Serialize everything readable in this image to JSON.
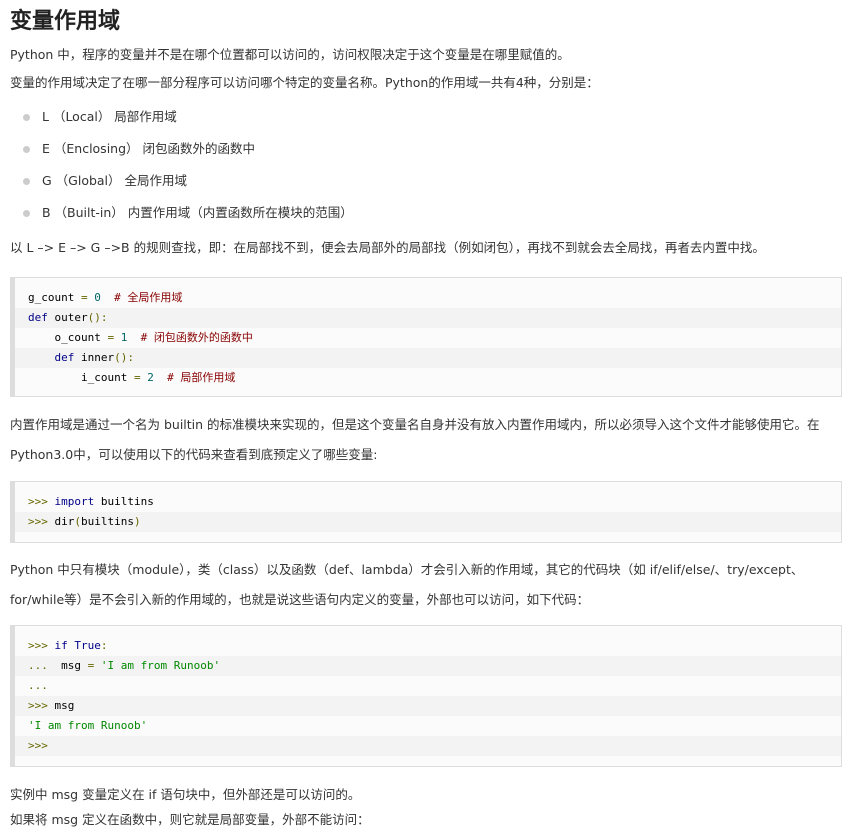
{
  "title": "变量作用域",
  "intro": [
    "Python 中，程序的变量并不是在哪个位置都可以访问的，访问权限决定于这个变量是在哪里赋值的。",
    "变量的作用域决定了在哪一部分程序可以访问哪个特定的变量名称。Python的作用域一共有4种，分别是："
  ],
  "scopes": [
    "L （Local） 局部作用域",
    "E （Enclosing） 闭包函数外的函数中",
    "G （Global） 全局作用域",
    "B （Built-in） 内置作用域（内置函数所在模块的范围）"
  ],
  "lookup_rule": "以 L –> E –> G –>B 的规则查找，即：在局部找不到，便会去局部外的局部找（例如闭包），再找不到就会去全局找，再者去内置中找。",
  "code1": {
    "line1": {
      "a": "g_count",
      "b": " = ",
      "c": "0",
      "d": "  ",
      "e": "# 全局作用域"
    },
    "line2": {
      "a": "def",
      "b": " outer",
      "c": "():"
    },
    "line3": {
      "a": "    o_count",
      "b": " = ",
      "c": "1",
      "d": "  ",
      "e": "# 闭包函数外的函数中"
    },
    "line4": {
      "a": "    ",
      "b": "def",
      "c": " inner",
      "d": "():"
    },
    "line5": {
      "a": "        i_count",
      "b": " = ",
      "c": "2",
      "d": "  ",
      "e": "# 局部作用域"
    }
  },
  "builtin_para": "内置作用域是通过一个名为 builtin 的标准模块来实现的，但是这个变量名自身并没有放入内置作用域内，所以必须导入这个文件才能够使用它。在Python3.0中，可以使用以下的代码来查看到底预定义了哪些变量:",
  "code2": {
    "line1": {
      "a": ">>>",
      "b": " ",
      "c": "import",
      "d": " builtins"
    },
    "line2": {
      "a": ">>>",
      "b": " dir",
      "c": "(",
      "d": "builtins",
      "e": ")"
    }
  },
  "module_para": "Python 中只有模块（module），类（class）以及函数（def、lambda）才会引入新的作用域，其它的代码块（如 if/elif/else/、try/except、for/while等）是不会引入新的作用域的，也就是说这些语句内定义的变量，外部也可以访问，如下代码：",
  "code3": {
    "line1": {
      "a": ">>>",
      "b": " ",
      "c": "if",
      "d": " ",
      "e": "True",
      "f": ":"
    },
    "line2": {
      "a": "...",
      "b": "  msg ",
      "c": "=",
      "d": " ",
      "e": "'I am from Runoob'"
    },
    "line3": {
      "a": "..."
    },
    "line4": {
      "a": ">>>",
      "b": " msg"
    },
    "line5": {
      "a": "'I am from Runoob'"
    },
    "line6": {
      "a": ">>>"
    }
  },
  "outro": [
    "实例中 msg 变量定义在 if 语句块中，但外部还是可以访问的。",
    "如果将 msg 定义在函数中，则它就是局部变量，外部不能访问："
  ]
}
